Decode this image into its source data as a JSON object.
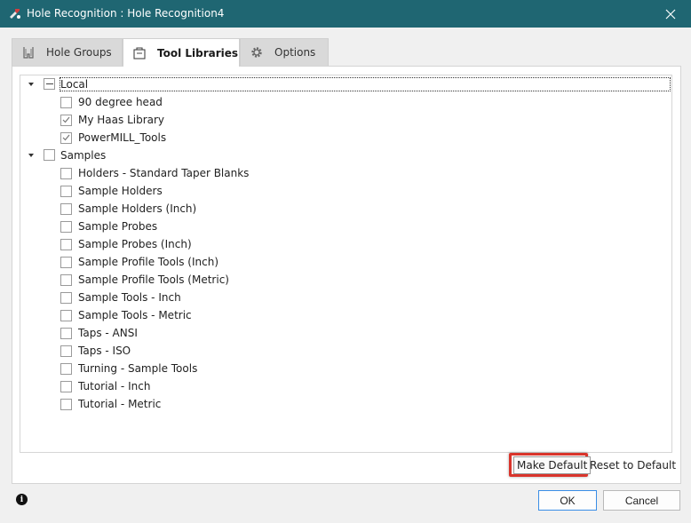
{
  "window": {
    "title": "Hole Recognition : Hole Recognition4",
    "app_icon": "hole-recognition-app-icon",
    "close_icon": "close-icon"
  },
  "tabs": [
    {
      "label": "Hole Groups",
      "icon": "hole-groups-icon",
      "active": false
    },
    {
      "label": "Tool Libraries",
      "icon": "tool-library-icon",
      "active": true
    },
    {
      "label": "Options",
      "icon": "gear-icon",
      "active": false
    }
  ],
  "tree": {
    "groups": [
      {
        "label": "Local",
        "state": "partial",
        "expanded": true,
        "items": [
          {
            "label": "90 degree head",
            "checked": false
          },
          {
            "label": "My Haas Library",
            "checked": true
          },
          {
            "label": "PowerMILL_Tools",
            "checked": true
          }
        ]
      },
      {
        "label": "Samples",
        "state": "unchecked",
        "expanded": true,
        "items": [
          {
            "label": "Holders - Standard Taper Blanks",
            "checked": false
          },
          {
            "label": "Sample Holders",
            "checked": false
          },
          {
            "label": "Sample Holders (Inch)",
            "checked": false
          },
          {
            "label": "Sample Probes",
            "checked": false
          },
          {
            "label": "Sample Probes (Inch)",
            "checked": false
          },
          {
            "label": "Sample Profile Tools (Inch)",
            "checked": false
          },
          {
            "label": "Sample Profile Tools (Metric)",
            "checked": false
          },
          {
            "label": "Sample Tools - Inch",
            "checked": false
          },
          {
            "label": "Sample Tools - Metric",
            "checked": false
          },
          {
            "label": "Taps - ANSI",
            "checked": false
          },
          {
            "label": "Taps - ISO",
            "checked": false
          },
          {
            "label": "Turning - Sample Tools",
            "checked": false
          },
          {
            "label": "Tutorial - Inch",
            "checked": false
          },
          {
            "label": "Tutorial - Metric",
            "checked": false
          }
        ]
      }
    ]
  },
  "actions": {
    "make_default": "Make Default",
    "reset_default": "Reset to Default"
  },
  "footer": {
    "info_icon": "info-icon",
    "ok": "OK",
    "cancel": "Cancel"
  },
  "colors": {
    "titlebar": "#1f6672",
    "highlight": "#d9342b",
    "ok_border": "#3a8ee6"
  }
}
